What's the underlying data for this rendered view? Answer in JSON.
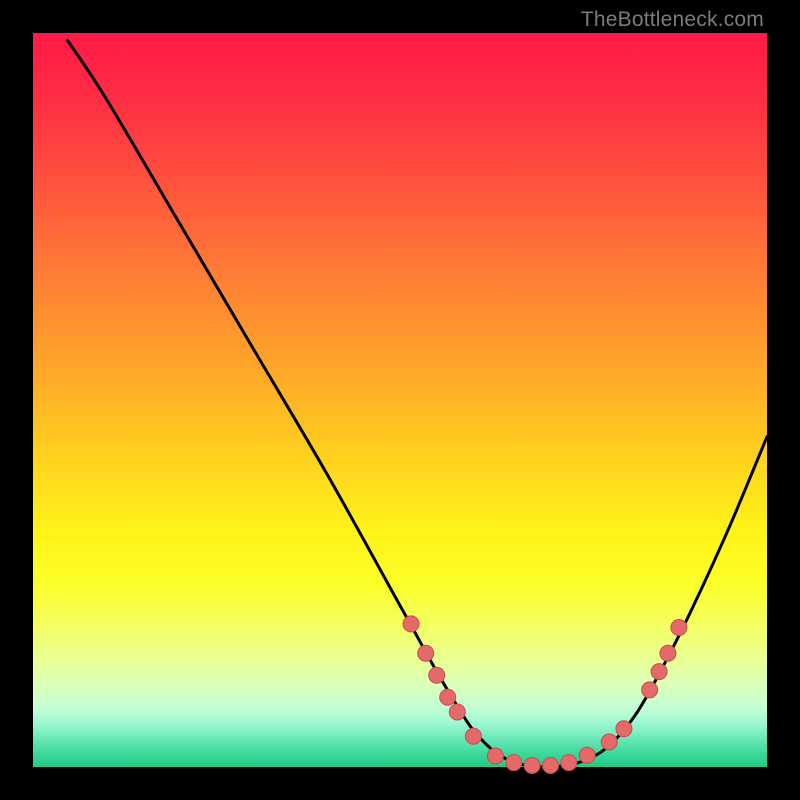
{
  "watermark": "TheBottleneck.com",
  "colors": {
    "page_bg": "#000000",
    "curve": "#000000",
    "point_fill": "#E46A6A",
    "point_stroke": "#C74E4E"
  },
  "chart_data": {
    "type": "line",
    "title": "",
    "xlabel": "",
    "ylabel": "",
    "xlim": [
      0,
      100
    ],
    "ylim": [
      0,
      100
    ],
    "series": [
      {
        "name": "curve",
        "x": [
          4.7,
          10,
          20,
          30,
          40,
          50,
          55,
          58,
          60,
          63,
          66,
          70,
          74,
          78,
          82,
          86,
          90,
          95,
          100
        ],
        "y": [
          99,
          91,
          74,
          57,
          40,
          22,
          13,
          8,
          5,
          2,
          0.5,
          0,
          0.5,
          2.5,
          7,
          14,
          22,
          33,
          45
        ]
      }
    ],
    "points": [
      {
        "x": 51.5,
        "y": 19.5
      },
      {
        "x": 53.5,
        "y": 15.5
      },
      {
        "x": 55.0,
        "y": 12.5
      },
      {
        "x": 56.5,
        "y": 9.5
      },
      {
        "x": 57.8,
        "y": 7.5
      },
      {
        "x": 60.0,
        "y": 4.2
      },
      {
        "x": 63.0,
        "y": 1.5
      },
      {
        "x": 65.5,
        "y": 0.6
      },
      {
        "x": 68.0,
        "y": 0.2
      },
      {
        "x": 70.5,
        "y": 0.2
      },
      {
        "x": 73.0,
        "y": 0.6
      },
      {
        "x": 75.5,
        "y": 1.6
      },
      {
        "x": 78.5,
        "y": 3.4
      },
      {
        "x": 80.5,
        "y": 5.2
      },
      {
        "x": 84.0,
        "y": 10.5
      },
      {
        "x": 85.3,
        "y": 13.0
      },
      {
        "x": 86.5,
        "y": 15.5
      },
      {
        "x": 88.0,
        "y": 19.0
      }
    ]
  }
}
